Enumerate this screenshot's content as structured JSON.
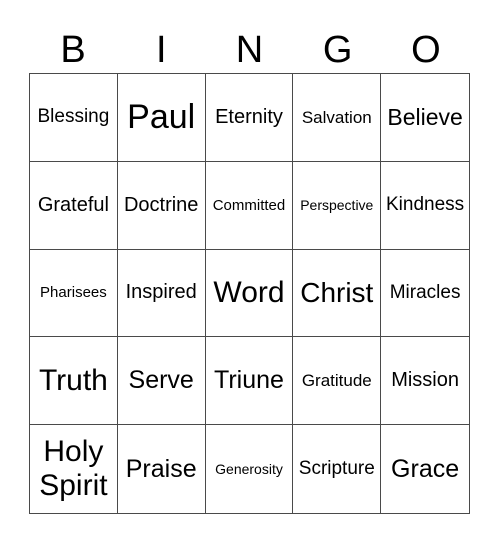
{
  "header": [
    "B",
    "I",
    "N",
    "G",
    "O"
  ],
  "cells": [
    "Blessing",
    "Paul",
    "Eternity",
    "Salvation",
    "Believe",
    "Grateful",
    "Doctrine",
    "Committed",
    "Perspective",
    "Kindness",
    "Pharisees",
    "Inspired",
    "Word",
    "Christ",
    "Miracles",
    "Truth",
    "Serve",
    "Triune",
    "Gratitude",
    "Mission",
    "Holy Spirit",
    "Praise",
    "Generosity",
    "Scripture",
    "Grace"
  ]
}
